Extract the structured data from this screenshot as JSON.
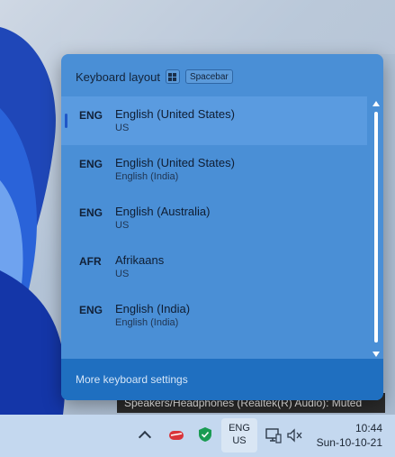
{
  "flyout": {
    "title": "Keyboard layout",
    "shortcut_key": "Spacebar",
    "footer_link": "More keyboard settings",
    "items": [
      {
        "code": "ENG",
        "name": "English (United States)",
        "sub": "US",
        "selected": true
      },
      {
        "code": "ENG",
        "name": "English (United States)",
        "sub": "English (India)"
      },
      {
        "code": "ENG",
        "name": "English (Australia)",
        "sub": "US"
      },
      {
        "code": "AFR",
        "name": "Afrikaans",
        "sub": "US"
      },
      {
        "code": "ENG",
        "name": "English (India)",
        "sub": "English (India)"
      }
    ]
  },
  "tooltip": {
    "text": "Speakers/Headphones (Realtek(R) Audio): Muted"
  },
  "taskbar": {
    "lang_line1": "ENG",
    "lang_line2": "US",
    "time": "10:44",
    "date": "Sun-10-10-21"
  },
  "colors": {
    "accent": "#1f6fc0",
    "flyout_bg": "#4a8fd6",
    "selection_bar": "#1f57c7"
  }
}
